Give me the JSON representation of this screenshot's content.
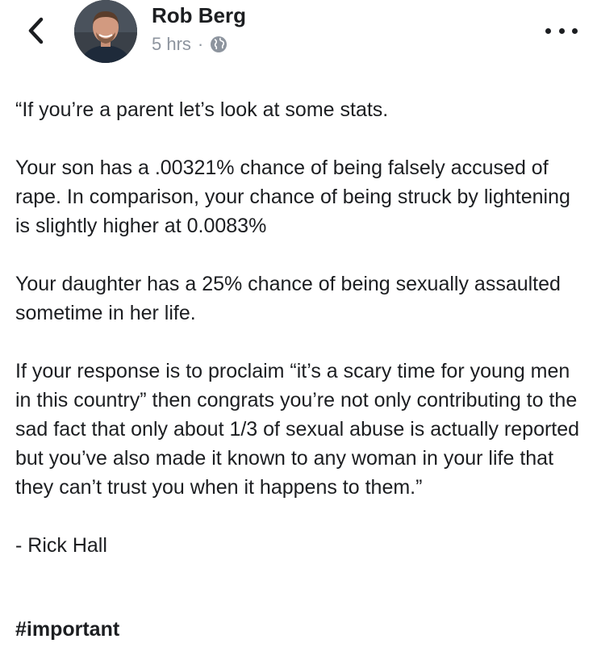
{
  "post": {
    "author": "Rob Berg",
    "time": "5 hrs",
    "separator": "·",
    "paragraphs": [
      "“If you’re a parent let’s look at some stats.",
      "Your son has a .00321% chance of being falsely accused of rape. In comparison, your chance of being struck by lightening is slightly higher at 0.0083%",
      "Your daughter has a 25% chance of being sexually assaulted sometime in her life.",
      "If your response is to proclaim “it’s a scary time for young men in this country” then congrats you’re not only contributing to the sad fact that only about 1/3 of sexual abuse is actually reported but you’ve also made it known to any woman in your life that they can’t trust you when it happens to them.”",
      "- Rick Hall"
    ],
    "hashtag": "#important"
  },
  "icons": {
    "back": "chevron-left-icon",
    "privacy": "globe-icon",
    "more": "more-dots-icon"
  }
}
